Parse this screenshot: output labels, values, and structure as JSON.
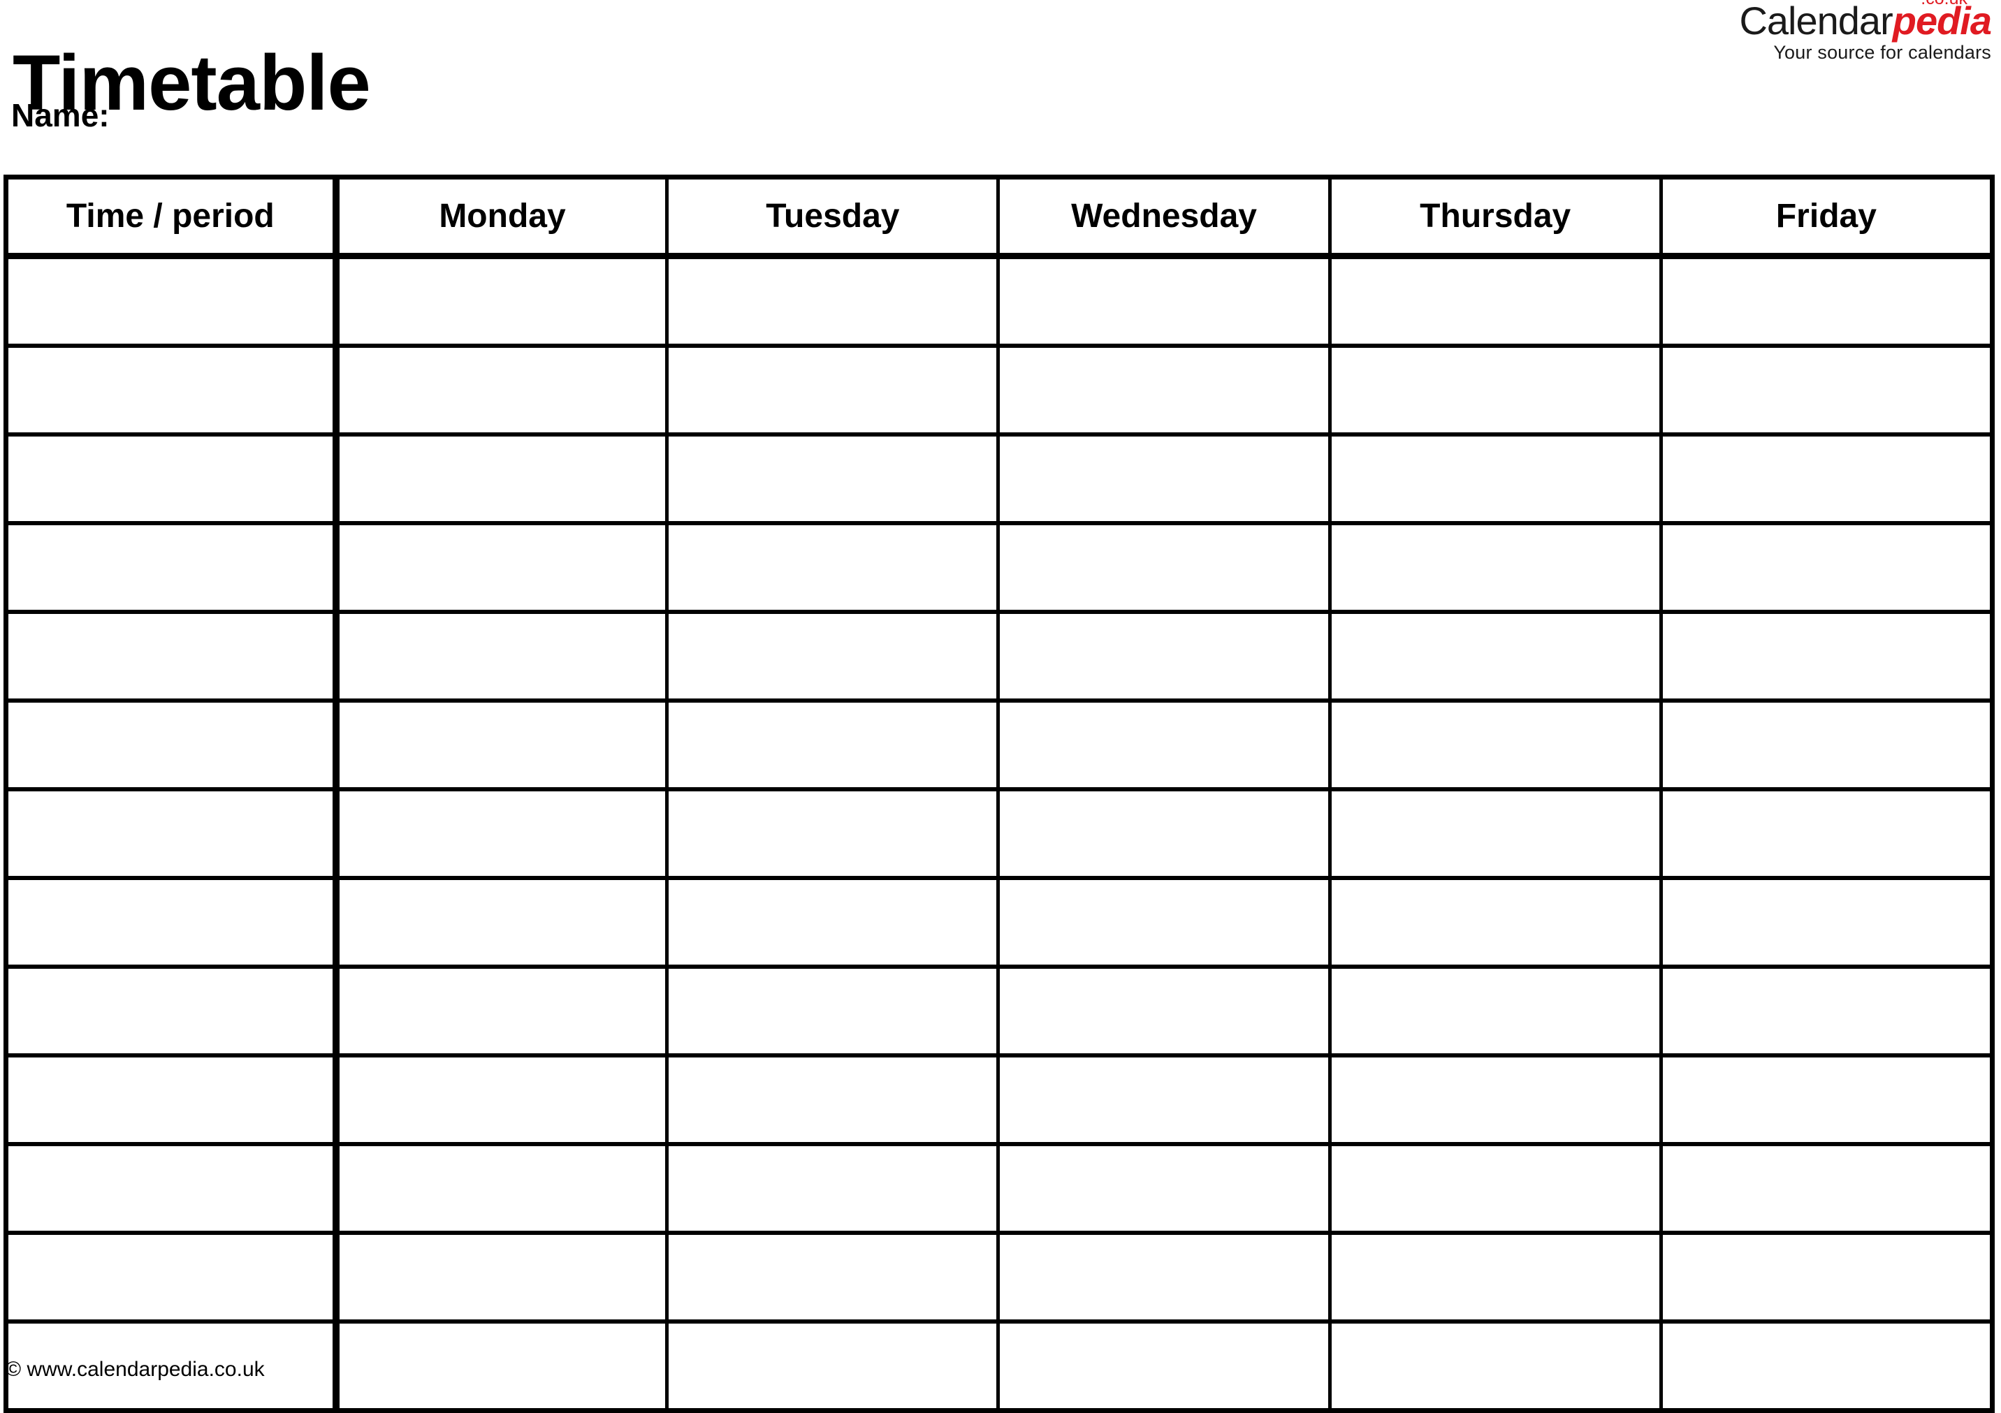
{
  "document": {
    "title": "Timetable",
    "name_label": "Name:"
  },
  "brand": {
    "name_primary": "Calendar",
    "name_secondary": "pedia",
    "tld": ".co.uk",
    "tagline": "Your source for calendars",
    "accent_color": "#e01b22",
    "text_color": "#1a1a1a"
  },
  "timetable": {
    "columns": [
      {
        "key": "time",
        "label": "Time / period"
      },
      {
        "key": "monday",
        "label": "Monday"
      },
      {
        "key": "tuesday",
        "label": "Tuesday"
      },
      {
        "key": "wednesday",
        "label": "Wednesday"
      },
      {
        "key": "thursday",
        "label": "Thursday"
      },
      {
        "key": "friday",
        "label": "Friday"
      }
    ],
    "row_count": 13,
    "rows": [
      {
        "time": "",
        "monday": "",
        "tuesday": "",
        "wednesday": "",
        "thursday": "",
        "friday": ""
      },
      {
        "time": "",
        "monday": "",
        "tuesday": "",
        "wednesday": "",
        "thursday": "",
        "friday": ""
      },
      {
        "time": "",
        "monday": "",
        "tuesday": "",
        "wednesday": "",
        "thursday": "",
        "friday": ""
      },
      {
        "time": "",
        "monday": "",
        "tuesday": "",
        "wednesday": "",
        "thursday": "",
        "friday": ""
      },
      {
        "time": "",
        "monday": "",
        "tuesday": "",
        "wednesday": "",
        "thursday": "",
        "friday": ""
      },
      {
        "time": "",
        "monday": "",
        "tuesday": "",
        "wednesday": "",
        "thursday": "",
        "friday": ""
      },
      {
        "time": "",
        "monday": "",
        "tuesday": "",
        "wednesday": "",
        "thursday": "",
        "friday": ""
      },
      {
        "time": "",
        "monday": "",
        "tuesday": "",
        "wednesday": "",
        "thursday": "",
        "friday": ""
      },
      {
        "time": "",
        "monday": "",
        "tuesday": "",
        "wednesday": "",
        "thursday": "",
        "friday": ""
      },
      {
        "time": "",
        "monday": "",
        "tuesday": "",
        "wednesday": "",
        "thursday": "",
        "friday": ""
      },
      {
        "time": "",
        "monday": "",
        "tuesday": "",
        "wednesday": "",
        "thursday": "",
        "friday": ""
      },
      {
        "time": "",
        "monday": "",
        "tuesday": "",
        "wednesday": "",
        "thursday": "",
        "friday": ""
      },
      {
        "time": "",
        "monday": "",
        "tuesday": "",
        "wednesday": "",
        "thursday": "",
        "friday": ""
      }
    ]
  },
  "footer": {
    "copyright": "© www.calendarpedia.co.uk"
  }
}
